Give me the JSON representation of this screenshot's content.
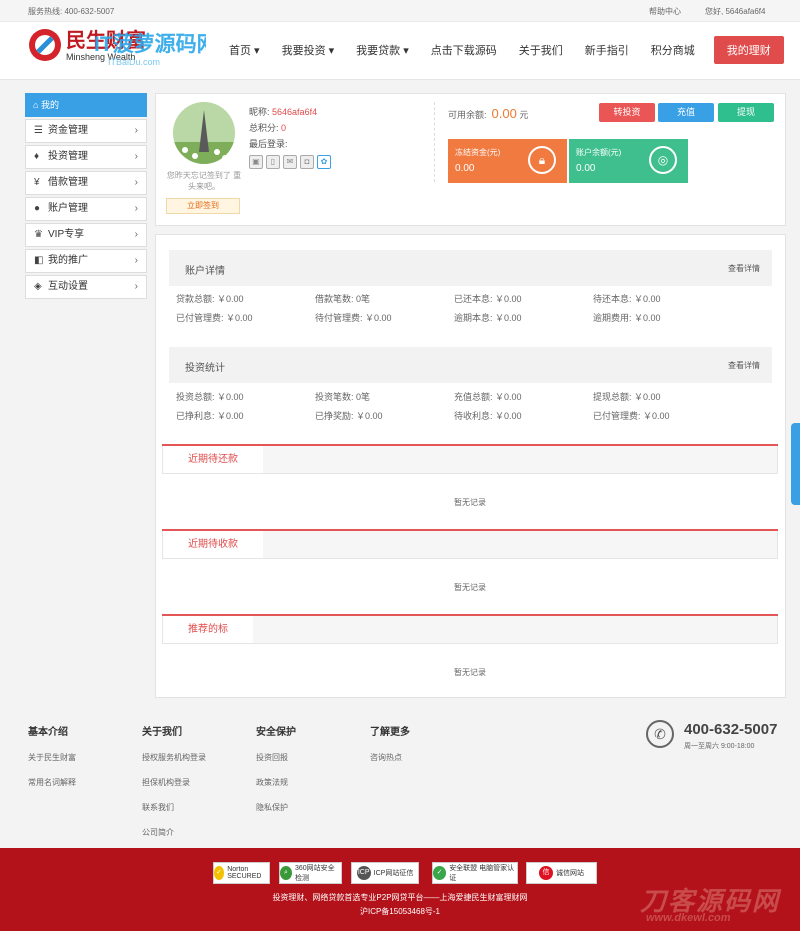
{
  "topbar": {
    "hotline": "服务热线: 400-632-5007",
    "help": "帮助中心",
    "greeting": "您好, 5646afa6f4"
  },
  "logo": {
    "cn": "民生财富",
    "en": "Minsheng Wealth",
    "watermark": "IT菠萝源码网",
    "url": "ITBaiDu.com"
  },
  "nav": {
    "items": [
      "首页",
      "我要投资",
      "我要贷款",
      "点击下载源码",
      "关于我们",
      "新手指引",
      "积分商城"
    ],
    "my": "我的理财"
  },
  "sidebar": {
    "head": "我的",
    "items": [
      {
        "label": "资金管理",
        "icon": "database-icon"
      },
      {
        "label": "投资管理",
        "icon": "money-bag-icon"
      },
      {
        "label": "借款管理",
        "icon": "yen-icon"
      },
      {
        "label": "账户管理",
        "icon": "user-icon"
      },
      {
        "label": "VIP专享",
        "icon": "crown-icon"
      },
      {
        "label": "我的推广",
        "icon": "share-icon"
      },
      {
        "label": "互动设置",
        "icon": "settings-icon"
      }
    ]
  },
  "profile": {
    "nickname_label": "昵称:",
    "nickname": "5646afa6f4",
    "points_label": "总积分:",
    "points": "0",
    "last_login_label": "最后登录:",
    "sign_text": "您昨天忘记签到了 重头来吧。",
    "sign_button": "立即签到"
  },
  "balance": {
    "label": "可用余额:",
    "value": "0.00",
    "unit": "元",
    "buttons": {
      "invest": "转投资",
      "recharge": "充值",
      "withdraw": "提现"
    },
    "frozen_label": "冻结资金(元)",
    "frozen_value": "0.00",
    "account_label": "账户余额(元)",
    "account_value": "0.00"
  },
  "colors": {
    "accent": "#3aa0e6",
    "red": "#e04b4b",
    "orange": "#f07a30",
    "green": "#2fbf8f",
    "frozen_card": "#f07a40",
    "account_card": "#3fbf8e"
  },
  "account": {
    "title": "账户详情",
    "more": "查看详情",
    "rows": [
      [
        "贷款总额: ￥0.00",
        "借款笔数: 0笔",
        "已还本息: ￥0.00",
        "待还本息: ￥0.00"
      ],
      [
        "已付管理费: ￥0.00",
        "待付管理费: ￥0.00",
        "逾期本息: ￥0.00",
        "逾期费用: ￥0.00"
      ]
    ]
  },
  "invest": {
    "title": "投资统计",
    "more": "查看详情",
    "rows": [
      [
        "投资总额: ￥0.00",
        "投资笔数: 0笔",
        "充值总额: ￥0.00",
        "提现总额: ￥0.00"
      ],
      [
        "已挣利息: ￥0.00",
        "已挣奖励: ￥0.00",
        "待收利息: ￥0.00",
        "已付管理费: ￥0.00"
      ]
    ]
  },
  "tabs": [
    {
      "label": "近期待还款",
      "empty": "暂无记录"
    },
    {
      "label": "近期待收款",
      "empty": "暂无记录"
    },
    {
      "label": "推荐的标",
      "empty": "暂无记录"
    }
  ],
  "footer": {
    "cols": [
      {
        "h": "基本介绍",
        "links": [
          "关于民生财富",
          "常用名词解释"
        ]
      },
      {
        "h": "关于我们",
        "links": [
          "授权服务机构登录",
          "担保机构登录",
          "联系我们",
          "公司简介"
        ]
      },
      {
        "h": "安全保护",
        "links": [
          "投资回报",
          "政策法规",
          "隐私保护"
        ]
      },
      {
        "h": "了解更多",
        "links": [
          "咨询热点"
        ]
      }
    ],
    "phone": "400-632-5007",
    "hours": "周一至周六 9:00-18:00"
  },
  "bottom": {
    "badges": [
      "Norton SECURED",
      "360网站安全检测",
      "ICP网站征信",
      "安全联盟 电脑管家认证",
      "诚信网站"
    ],
    "line1": "投资理财、网络贷款首选专业P2P网贷平台——上海爱捷民生财富理财网",
    "icp": "沪ICP备15053468号-1",
    "wm1": "刀客源码网",
    "wm2": "www.dkewl.com"
  }
}
